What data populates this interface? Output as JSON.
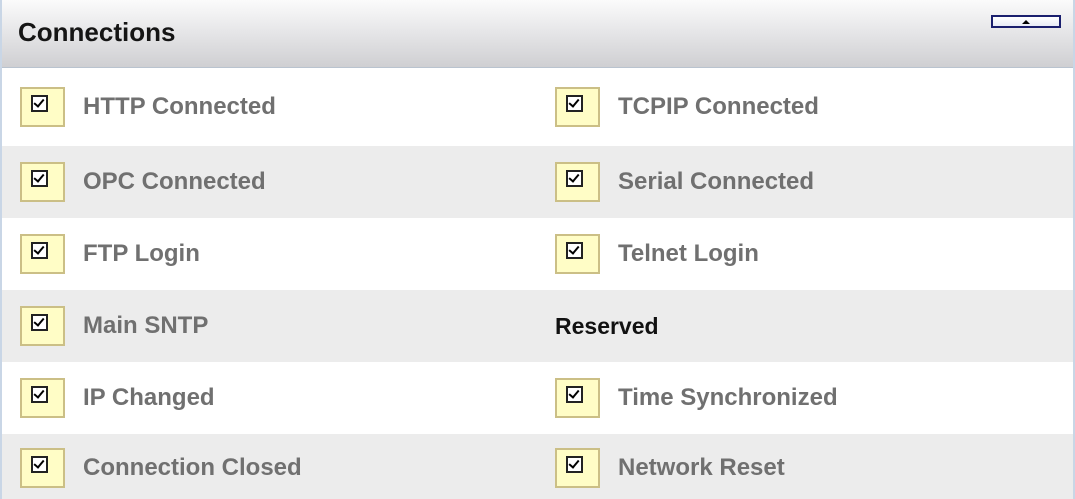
{
  "panel": {
    "title": "Connections",
    "collapse_button_icon": "caret-up-icon"
  },
  "rows": [
    {
      "left": {
        "label": "HTTP Connected",
        "checked": true
      },
      "right": {
        "label": "TCPIP Connected",
        "checked": true
      }
    },
    {
      "left": {
        "label": "OPC Connected",
        "checked": true
      },
      "right": {
        "label": "Serial Connected",
        "checked": true
      }
    },
    {
      "left": {
        "label": "FTP Login",
        "checked": true
      },
      "right": {
        "label": "Telnet Login",
        "checked": true
      }
    },
    {
      "left": {
        "label": "Main SNTP",
        "checked": true
      },
      "right": {
        "label": "Reserved",
        "checked": null
      }
    },
    {
      "left": {
        "label": "IP Changed",
        "checked": true
      },
      "right": {
        "label": "Time Synchronized",
        "checked": true
      }
    },
    {
      "left": {
        "label": "Connection Closed",
        "checked": true
      },
      "right": {
        "label": "Network Reset",
        "checked": true
      }
    }
  ],
  "colors": {
    "row_alt_bg": "#ececec",
    "checkbox_bg": "#fffdc6",
    "checkbox_border": "#cbbf86",
    "label_gray": "#707070",
    "label_dark": "#111111"
  }
}
